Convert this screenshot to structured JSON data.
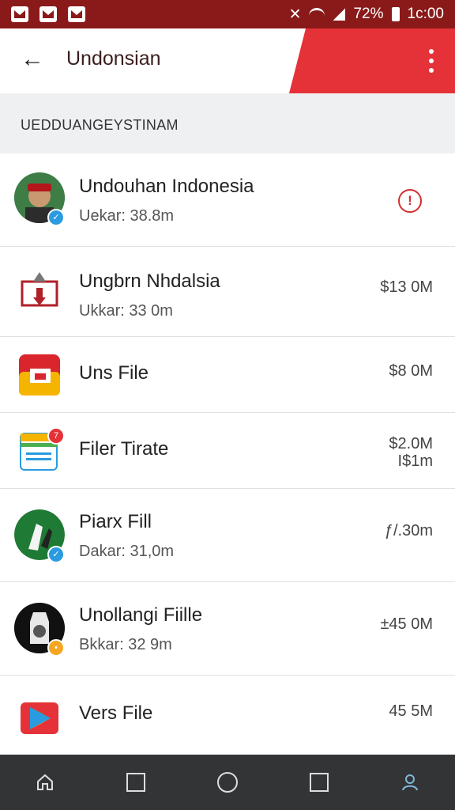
{
  "status_bar": {
    "time": "1c:00",
    "battery": "72%"
  },
  "app_bar": {
    "title": "Undonsian"
  },
  "section": {
    "label": "UEDDUANGEYSTINAM"
  },
  "rows": [
    {
      "name": "Undouhan Indonesia",
      "sub": "Uekar: 38.8m",
      "size": ""
    },
    {
      "name": "Ungbrn Nhdalsia",
      "sub": "Ukkar: 33 0m",
      "size": "$13 0M"
    },
    {
      "name": "Uns File",
      "sub": "",
      "size": "$8 0M"
    },
    {
      "name": "Filer Tirate",
      "sub": "",
      "size": "$2.0M",
      "size2": "I$1m"
    },
    {
      "name": "Piarx Fill",
      "sub": "Dakar: 31,0m",
      "size": "ƒ/.30m"
    },
    {
      "name": "Unollangi Fiille",
      "sub": "Bkkar: 32 9m",
      "size": "±45 0M"
    },
    {
      "name": "Vers File",
      "sub": "",
      "size": "45 5M"
    }
  ],
  "colors": {
    "accent": "#e53238",
    "status_bar": "#8a1a1a",
    "nav_bar": "#333436",
    "warning": "#d32f2f",
    "check_badge": "#2a9be0"
  }
}
